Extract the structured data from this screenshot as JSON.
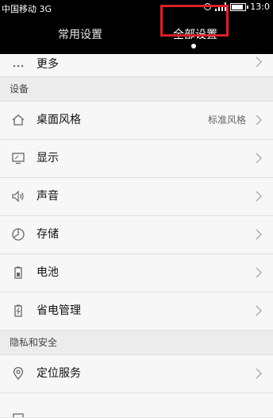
{
  "status_bar": {
    "carrier": "中国移动 3G",
    "time": "13:0",
    "icons": [
      "alarm-icon",
      "signal-icon",
      "battery-icon"
    ]
  },
  "tabs": {
    "common": "常用设置",
    "all": "全部设置",
    "active": "all"
  },
  "top_item": {
    "label": "更多",
    "icon": "more-dots-icon"
  },
  "sections": [
    {
      "title": "设备",
      "items": [
        {
          "label": "桌面风格",
          "value": "标准风格",
          "icon": "home-icon"
        },
        {
          "label": "显示",
          "value": "",
          "icon": "display-icon"
        },
        {
          "label": "声音",
          "value": "",
          "icon": "speaker-icon"
        },
        {
          "label": "存储",
          "value": "",
          "icon": "pie-chart-icon"
        },
        {
          "label": "电池",
          "value": "",
          "icon": "battery-icon"
        },
        {
          "label": "省电管理",
          "value": "",
          "icon": "power-saving-icon"
        }
      ]
    },
    {
      "title": "隐私和安全",
      "items": [
        {
          "label": "定位服务",
          "value": "",
          "icon": "location-icon"
        }
      ]
    }
  ],
  "colors": {
    "highlight": "#d8202a",
    "header_bg": "#000000",
    "list_bg": "#f7f7f7"
  }
}
